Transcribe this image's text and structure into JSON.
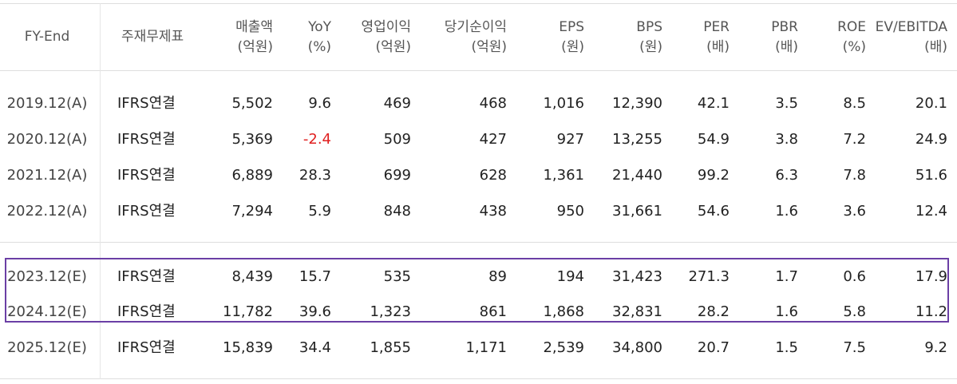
{
  "header": {
    "fy_end": "FY-End",
    "basis": "주재무제표",
    "revenue": [
      "매출액",
      "(억원)"
    ],
    "yoy": [
      "YoY",
      "(%)"
    ],
    "op_income": [
      "영업이익",
      "(억원)"
    ],
    "net_income": [
      "당기순이익",
      "(억원)"
    ],
    "eps": [
      "EPS",
      "(원)"
    ],
    "bps": [
      "BPS",
      "(원)"
    ],
    "per": [
      "PER",
      "(배)"
    ],
    "pbr": [
      "PBR",
      "(배)"
    ],
    "roe": [
      "ROE",
      "(%)"
    ],
    "ev_ebitda": [
      "EV/EBITDA",
      "(배)"
    ]
  },
  "rows": [
    {
      "fy": "2019.12(A)",
      "basis": "IFRS연결",
      "revenue": "5,502",
      "yoy": "9.6",
      "op": "469",
      "net": "468",
      "eps": "1,016",
      "bps": "12,390",
      "per": "42.1",
      "pbr": "3.5",
      "roe": "8.5",
      "ev": "20.1"
    },
    {
      "fy": "2020.12(A)",
      "basis": "IFRS연결",
      "revenue": "5,369",
      "yoy": "-2.4",
      "op": "509",
      "net": "427",
      "eps": "927",
      "bps": "13,255",
      "per": "54.9",
      "pbr": "3.8",
      "roe": "7.2",
      "ev": "24.9"
    },
    {
      "fy": "2021.12(A)",
      "basis": "IFRS연결",
      "revenue": "6,889",
      "yoy": "28.3",
      "op": "699",
      "net": "628",
      "eps": "1,361",
      "bps": "21,440",
      "per": "99.2",
      "pbr": "6.3",
      "roe": "7.8",
      "ev": "51.6"
    },
    {
      "fy": "2022.12(A)",
      "basis": "IFRS연결",
      "revenue": "7,294",
      "yoy": "5.9",
      "op": "848",
      "net": "438",
      "eps": "950",
      "bps": "31,661",
      "per": "54.6",
      "pbr": "1.6",
      "roe": "3.6",
      "ev": "12.4"
    },
    {
      "fy": "2023.12(E)",
      "basis": "IFRS연결",
      "revenue": "8,439",
      "yoy": "15.7",
      "op": "535",
      "net": "89",
      "eps": "194",
      "bps": "31,423",
      "per": "271.3",
      "pbr": "1.7",
      "roe": "0.6",
      "ev": "17.9"
    },
    {
      "fy": "2024.12(E)",
      "basis": "IFRS연결",
      "revenue": "11,782",
      "yoy": "39.6",
      "op": "1,323",
      "net": "861",
      "eps": "1,868",
      "bps": "32,831",
      "per": "28.2",
      "pbr": "1.6",
      "roe": "5.8",
      "ev": "11.2"
    },
    {
      "fy": "2025.12(E)",
      "basis": "IFRS연결",
      "revenue": "15,839",
      "yoy": "34.4",
      "op": "1,855",
      "net": "1,171",
      "eps": "2,539",
      "bps": "34,800",
      "per": "20.7",
      "pbr": "1.5",
      "roe": "7.5",
      "ev": "9.2"
    }
  ],
  "colors": {
    "negative": "#e02020",
    "highlight_border": "#6b3fa5",
    "grid": "#dedede"
  }
}
